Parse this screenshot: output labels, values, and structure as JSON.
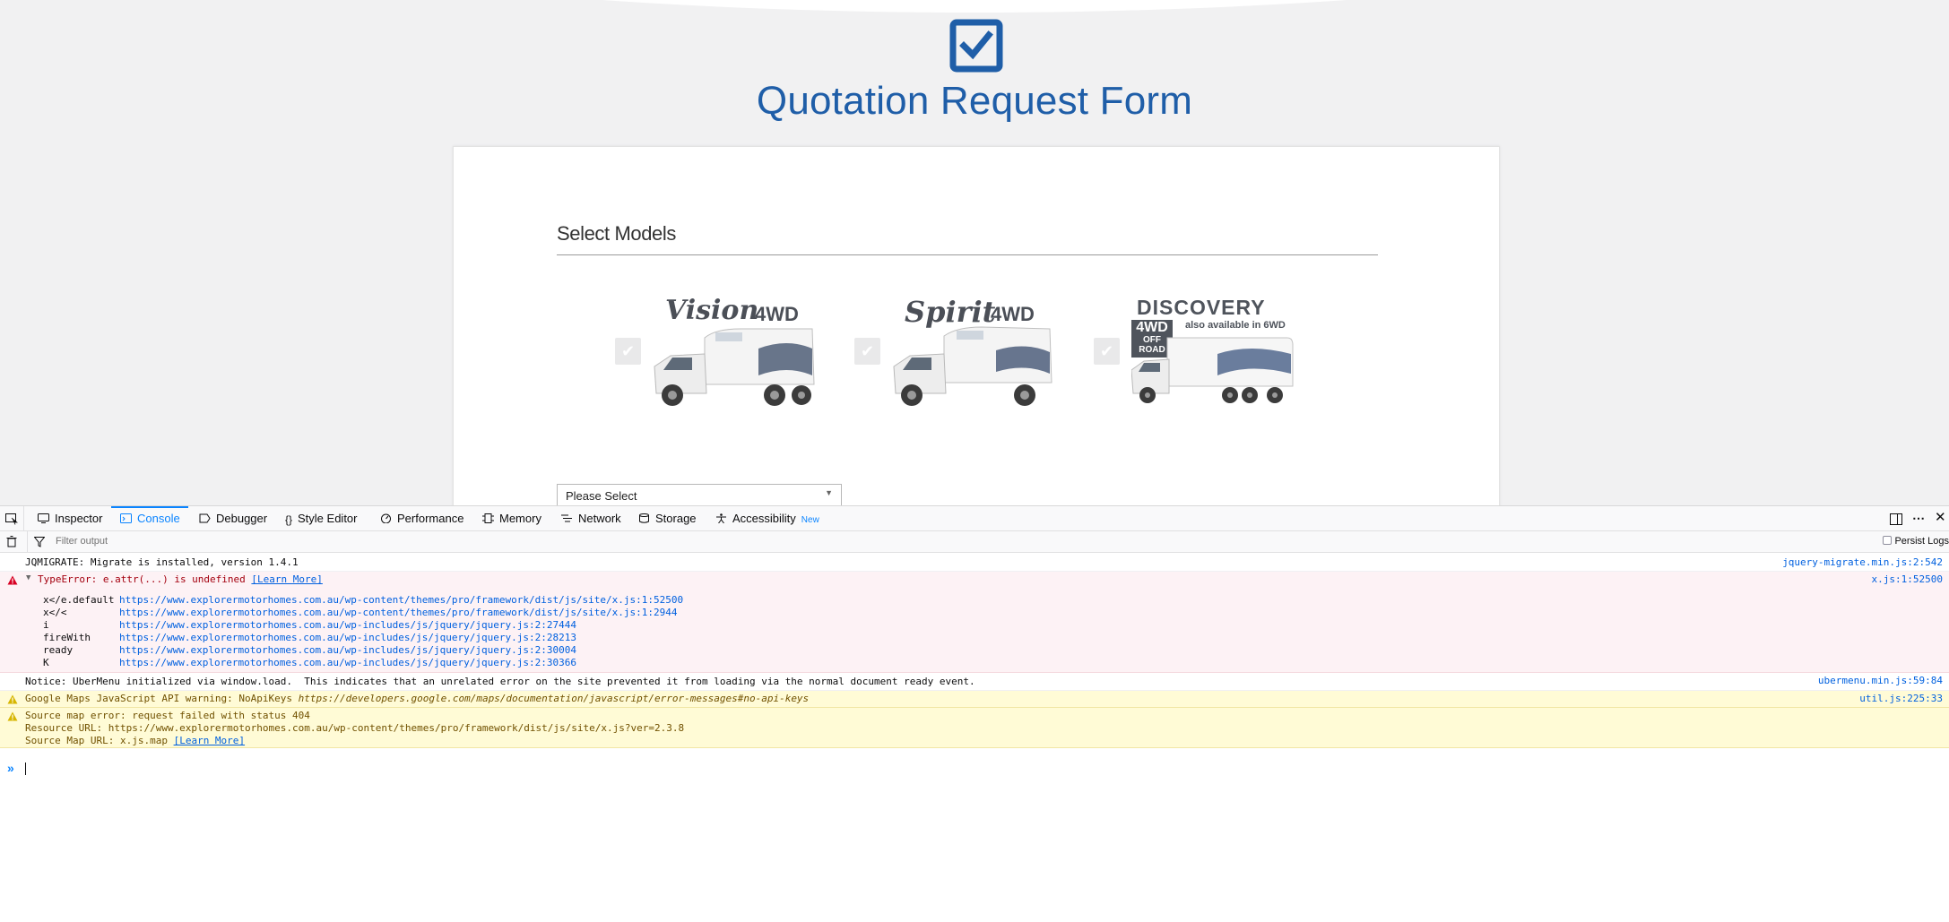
{
  "page": {
    "title": "Quotation Request Form",
    "section_title": "Select Models",
    "checkmark": "✔",
    "models": [
      {
        "brand": "Vision",
        "suffix": "4WD",
        "tagline": "",
        "badge": []
      },
      {
        "brand": "Spirit",
        "suffix": "4WD",
        "tagline": "",
        "badge": []
      },
      {
        "brand": "DISCOVERY",
        "suffix": "",
        "tagline": "also available in 6WD",
        "badge": [
          "4WD",
          "OFF",
          "ROAD"
        ]
      }
    ],
    "select": {
      "value": "Please Select"
    }
  },
  "devtools": {
    "tabs": [
      {
        "label": "Inspector",
        "icon": "inspector-icon"
      },
      {
        "label": "Console",
        "icon": "console-icon",
        "active": true
      },
      {
        "label": "Debugger",
        "icon": "debugger-icon"
      },
      {
        "label": "Style Editor",
        "icon": "style-editor-icon"
      },
      {
        "label": "Performance",
        "icon": "performance-icon"
      },
      {
        "label": "Memory",
        "icon": "memory-icon"
      },
      {
        "label": "Network",
        "icon": "network-icon"
      },
      {
        "label": "Storage",
        "icon": "storage-icon"
      },
      {
        "label": "Accessibility",
        "icon": "accessibility-icon",
        "badge": "New"
      }
    ],
    "filter_placeholder": "Filter output",
    "persist_logs": "Persist Logs",
    "colors": {
      "accent": "#0a84ff",
      "error_bg": "#fdf2f5",
      "warn_bg": "#fffbd6",
      "link": "#0060df"
    },
    "messages": {
      "m1": {
        "text": "JQMIGRATE: Migrate is installed, version 1.4.1",
        "source": "jquery-migrate.min.js:2:542"
      },
      "m2": {
        "text": "TypeError: e.attr(...) is undefined",
        "learn_more": "[Learn More]",
        "source": "x.js:1:52500",
        "trace": [
          {
            "fn": "x</e.default",
            "url": "https://www.explorermotorhomes.com.au/wp-content/themes/pro/framework/dist/js/site/x.js:1:52500"
          },
          {
            "fn": "x</<",
            "url": "https://www.explorermotorhomes.com.au/wp-content/themes/pro/framework/dist/js/site/x.js:1:2944"
          },
          {
            "fn": "i",
            "url": "https://www.explorermotorhomes.com.au/wp-includes/js/jquery/jquery.js:2:27444"
          },
          {
            "fn": "fireWith",
            "url": "https://www.explorermotorhomes.com.au/wp-includes/js/jquery/jquery.js:2:28213"
          },
          {
            "fn": "ready",
            "url": "https://www.explorermotorhomes.com.au/wp-includes/js/jquery/jquery.js:2:30004"
          },
          {
            "fn": "K",
            "url": "https://www.explorermotorhomes.com.au/wp-includes/js/jquery/jquery.js:2:30366"
          }
        ]
      },
      "m3": {
        "text": "Notice: UberMenu initialized via window.load.  This indicates that an unrelated error on the site prevented it from loading via the normal document ready event.",
        "source": "ubermenu.min.js:59:84"
      },
      "m4": {
        "text": "Google Maps JavaScript API warning: NoApiKeys ",
        "url": "https://developers.google.com/maps/documentation/javascript/error-messages#no-api-keys",
        "source": "util.js:225:33"
      },
      "m5": {
        "line1": "Source map error: request failed with status 404",
        "line2": "Resource URL: https://www.explorermotorhomes.com.au/wp-content/themes/pro/framework/dist/js/site/x.js?ver=2.3.8",
        "line3": "Source Map URL: x.js.map ",
        "learn_more": "[Learn More]"
      }
    },
    "prompt": "»"
  }
}
